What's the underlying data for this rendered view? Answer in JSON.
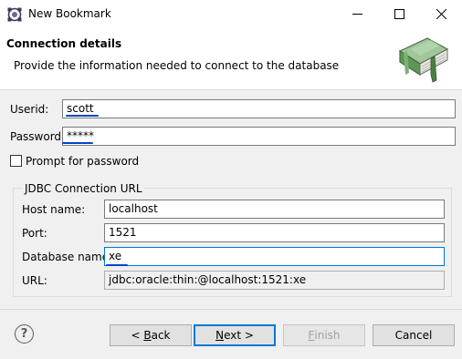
{
  "window": {
    "title": "New Bookmark",
    "minimize_glyph": "—",
    "maximize_glyph": "☐",
    "close_glyph": "✕"
  },
  "banner": {
    "title": "Connection details",
    "description": "Provide the information needed to connect to the database",
    "icon": "book-icon"
  },
  "form": {
    "userid_label": "Userid:",
    "userid_value": "scott",
    "password_label": "Password:",
    "password_value": "*****",
    "prompt_label": "Prompt for password",
    "prompt_checked": false
  },
  "jdbc": {
    "group_label": "JDBC Connection URL",
    "host_label": "Host name:",
    "host_value": "localhost",
    "port_label": "Port:",
    "port_value": "1521",
    "db_label": "Database name:",
    "db_value": "xe",
    "url_label": "URL:",
    "url_value": "jdbc:oracle:thin:@localhost:1521:xe"
  },
  "buttons": {
    "help": "?",
    "back_prefix": "< ",
    "back_mnemonic": "B",
    "back_rest": "ack",
    "next_mnemonic": "N",
    "next_rest": "ext >",
    "finish_mnemonic": "F",
    "finish_rest": "inish",
    "cancel": "Cancel"
  },
  "colors": {
    "accent": "#0078d7",
    "spell_underline": "#0046c8"
  }
}
